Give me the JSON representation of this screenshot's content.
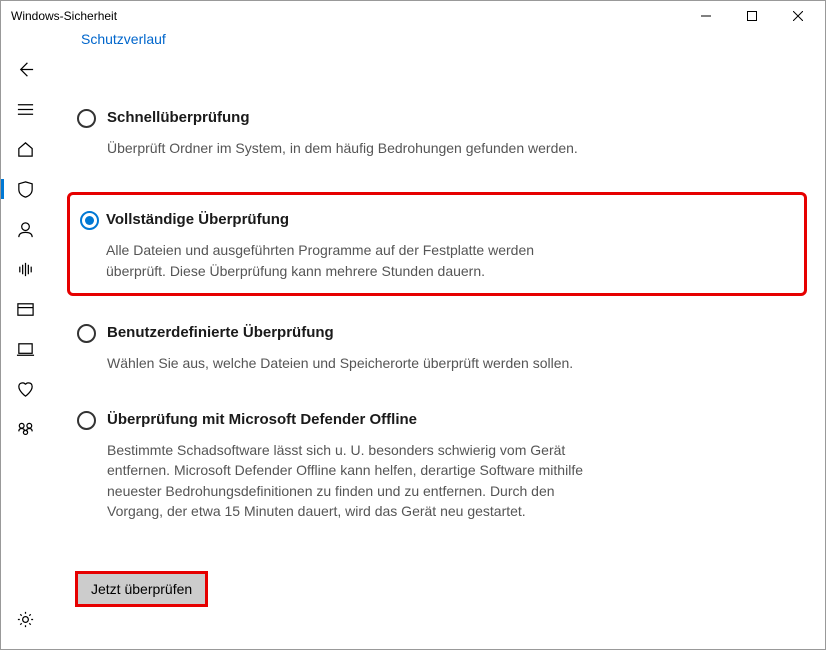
{
  "window": {
    "title": "Windows-Sicherheit"
  },
  "topLink": "Schutzverlauf",
  "options": {
    "quick": {
      "title": "Schnellüberprüfung",
      "desc": "Überprüft Ordner im System, in dem häufig Bedrohungen gefunden werden."
    },
    "full": {
      "title": "Vollständige Überprüfung",
      "desc": "Alle Dateien und ausgeführten Programme auf der Festplatte werden überprüft. Diese Überprüfung kann mehrere Stunden dauern."
    },
    "custom": {
      "title": "Benutzerdefinierte Überprüfung",
      "desc": "Wählen Sie aus, welche Dateien und Speicherorte überprüft werden sollen."
    },
    "offline": {
      "title": "Überprüfung mit Microsoft Defender Offline",
      "desc": "Bestimmte Schadsoftware lässt sich u. U. besonders schwierig vom Gerät entfernen. Microsoft Defender Offline kann helfen, derartige Software mithilfe neuester Bedrohungsdefinitionen zu finden und zu entfernen. Durch den Vorgang, der etwa 15 Minuten dauert, wird das Gerät neu gestartet."
    }
  },
  "actionButton": "Jetzt überprüfen"
}
